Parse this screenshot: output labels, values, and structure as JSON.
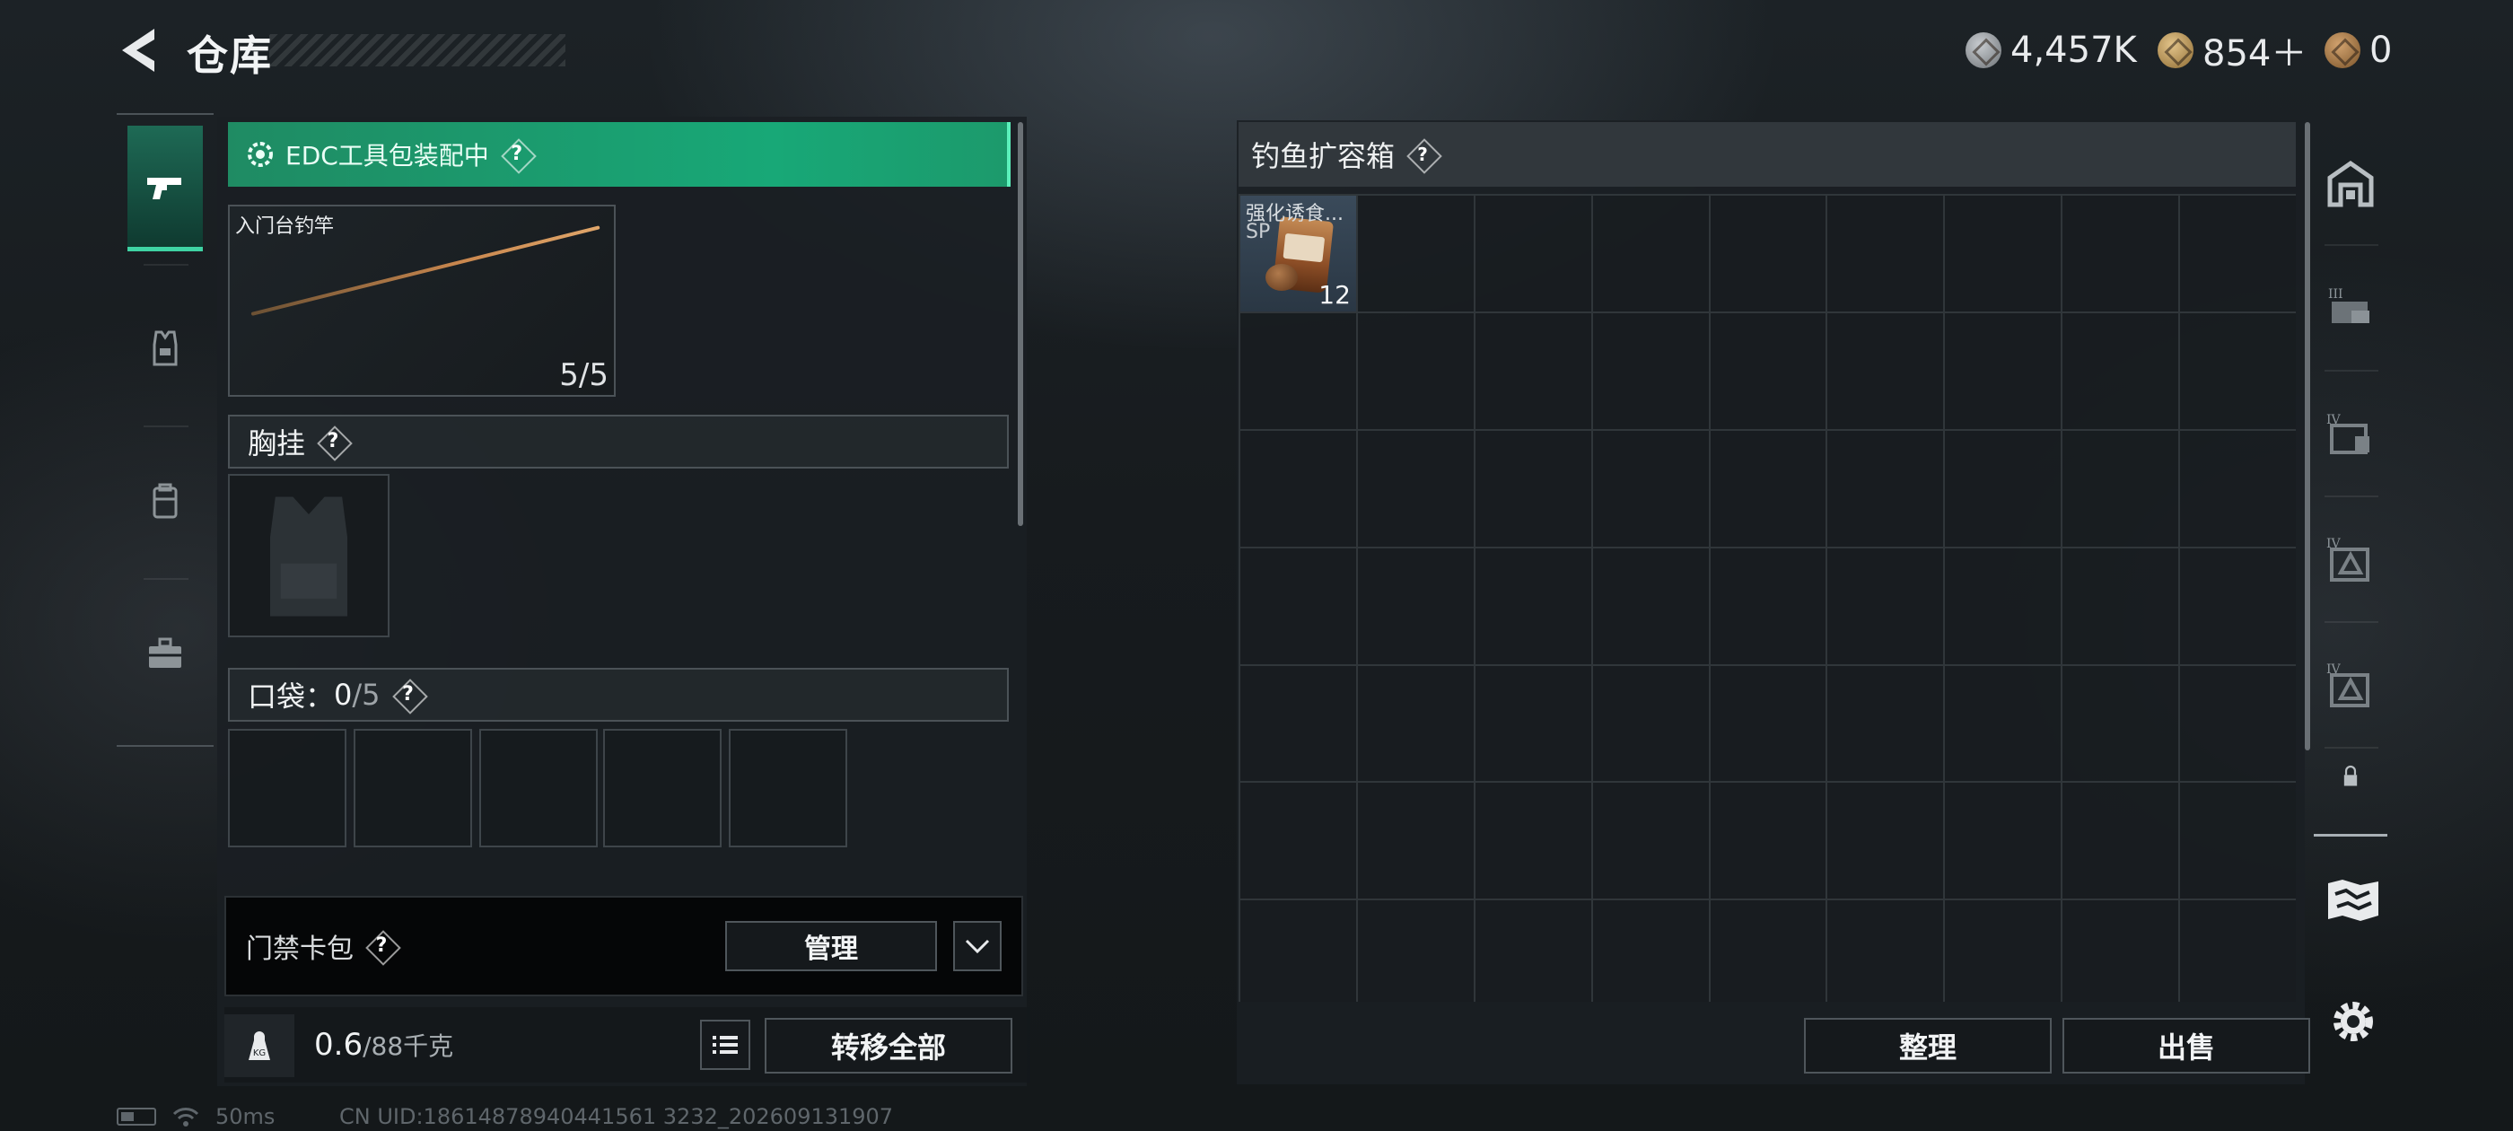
{
  "header": {
    "title": "仓库",
    "currencies": [
      {
        "icon": "silver-coin-icon",
        "value": "4,457K"
      },
      {
        "icon": "gold-coin-icon",
        "value": "854＋"
      },
      {
        "icon": "bronze-coin-icon",
        "value": "0"
      }
    ]
  },
  "left_rail": {
    "items": [
      {
        "icon": "pistol-icon",
        "active": true
      },
      {
        "icon": "armor-vest-icon",
        "active": false
      },
      {
        "icon": "backpack-icon",
        "active": false
      },
      {
        "icon": "toolbox-icon",
        "active": false
      }
    ]
  },
  "loadout": {
    "edc_banner": "EDC工具包装配中",
    "rod": {
      "name": "入门台钓竿",
      "count": "5/5"
    },
    "chest_rig": {
      "label": "胸挂"
    },
    "pockets": {
      "label": "口袋：",
      "current": "0",
      "max": "/5",
      "slots": 5
    },
    "keycard": {
      "label": "门禁卡包",
      "manage": "管理"
    },
    "weight": {
      "current": "0.6",
      "max": "/88千克",
      "kg_icon_text": "KG"
    },
    "transfer_all": "转移全部"
  },
  "container": {
    "title": "钓鱼扩容箱",
    "item": {
      "name": "强化诱食...",
      "sub": "SP",
      "qty": "12"
    },
    "sort": "整理",
    "sell": "出售"
  },
  "right_rail": {
    "items": [
      {
        "icon": "stash-home-icon"
      },
      {
        "icon": "container-iii-icon",
        "tier": "III"
      },
      {
        "icon": "container-iv-icon",
        "tier": "IV"
      },
      {
        "icon": "container-iv-icon",
        "tier": "IV"
      },
      {
        "icon": "container-iv-icon",
        "tier": "IV"
      },
      {
        "icon": "lock-icon"
      }
    ]
  },
  "status": {
    "ping": "50ms",
    "uid": "CN UID:18614878940441561 3232_202609131907"
  },
  "colors": {
    "accent_green": "#18a877",
    "active_tab": "#1e6a55"
  }
}
